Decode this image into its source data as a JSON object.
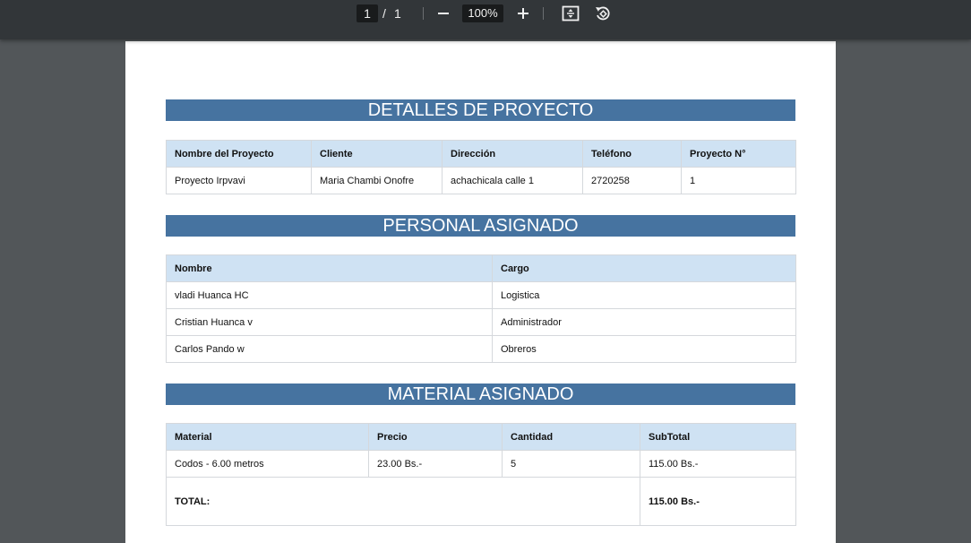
{
  "viewer": {
    "current_page": "1",
    "page_separator": "/",
    "total_pages": "1",
    "zoom": "100%"
  },
  "sections": {
    "project_title": "DETALLES DE PROYECTO",
    "personnel_title": "PERSONAL ASIGNADO",
    "material_title": "MATERIAL ASIGNADO"
  },
  "project": {
    "headers": [
      "Nombre del Proyecto",
      "Cliente",
      "Dirección",
      "Teléfono",
      "Proyecto N°"
    ],
    "row": [
      "Proyecto Irpvavi",
      "Maria Chambi Onofre",
      "achachicala calle 1",
      "2720258",
      "1"
    ]
  },
  "personnel": {
    "headers": [
      "Nombre",
      "Cargo"
    ],
    "rows": [
      [
        "vladi Huanca HC",
        "Logistica"
      ],
      [
        "Cristian Huanca v",
        "Administrador"
      ],
      [
        "Carlos Pando w",
        "Obreros"
      ]
    ]
  },
  "material": {
    "headers": [
      "Material",
      "Precio",
      "Cantidad",
      "SubTotal"
    ],
    "rows": [
      [
        "Codos - 6.00 metros",
        "23.00 Bs.-",
        "5",
        "115.00 Bs.-"
      ]
    ],
    "total_label": "TOTAL:",
    "total_value": "115.00 Bs.-"
  },
  "colors": {
    "toolbar": "#323639",
    "background": "#525659",
    "section_header": "#4673a0",
    "table_header": "#cfe2f3"
  },
  "icons": [
    "zoom-out-icon",
    "zoom-in-icon",
    "fit-page-icon",
    "rotate-icon"
  ]
}
